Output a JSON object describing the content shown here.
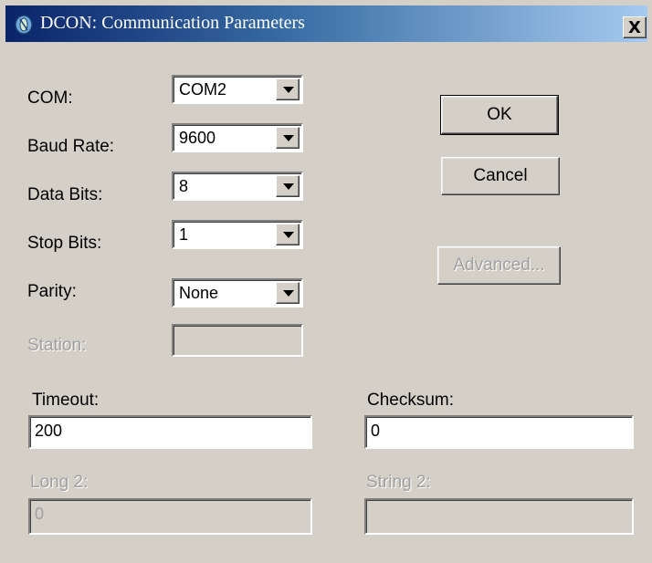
{
  "window": {
    "title": "DCON: Communication Parameters",
    "close_label": "X"
  },
  "fields": {
    "com": {
      "label": "COM:",
      "value": "COM2"
    },
    "baud_rate": {
      "label": "Baud Rate:",
      "value": "9600"
    },
    "data_bits": {
      "label": "Data Bits:",
      "value": "8"
    },
    "stop_bits": {
      "label": "Stop Bits:",
      "value": "1"
    },
    "parity": {
      "label": "Parity:",
      "value": "None"
    },
    "station": {
      "label": "Station:",
      "value": ""
    }
  },
  "buttons": {
    "ok": "OK",
    "cancel": "Cancel",
    "advanced": "Advanced..."
  },
  "timeout": {
    "label": "Timeout:",
    "value": "200"
  },
  "checksum": {
    "label": "Checksum:",
    "value": "0"
  },
  "long2": {
    "label": "Long 2:",
    "value": "0"
  },
  "string2": {
    "label": "String 2:",
    "value": ""
  },
  "colors": {
    "dialog_bg": "#d4d0c8",
    "title_start": "#0a246a",
    "title_end": "#a6caf0",
    "disabled_text": "#a0a0a0"
  }
}
